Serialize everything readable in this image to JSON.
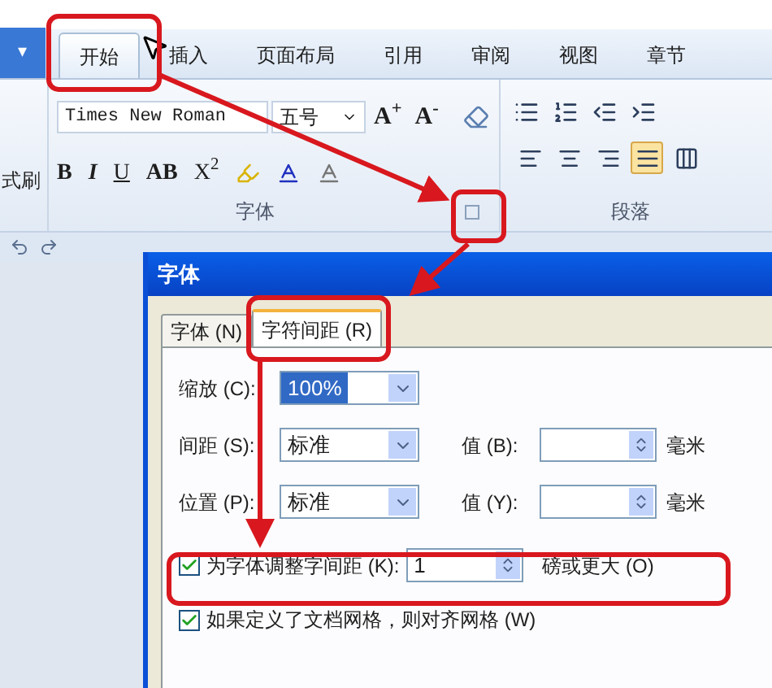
{
  "ribbon": {
    "menu_button": "▾",
    "tabs": [
      {
        "label": "开始",
        "selected": true
      },
      {
        "label": "插入",
        "selected": false
      },
      {
        "label": "页面布局",
        "selected": false
      },
      {
        "label": "引用",
        "selected": false
      },
      {
        "label": "审阅",
        "selected": false
      },
      {
        "label": "视图",
        "selected": false
      },
      {
        "label": "章节",
        "selected": false
      }
    ],
    "clipboard_label": "式刷",
    "font_group": {
      "title": "字体",
      "font_name": "Times New Roman",
      "font_size": "五号",
      "size_buttons": [
        "A$^{+}$",
        "A$^{-}$"
      ],
      "style_buttons": [
        "B",
        "I",
        "U",
        "AB",
        "X$^{2}$"
      ]
    },
    "paragraph_group": {
      "title": "段落",
      "align_buttons": [
        {
          "kind": "left",
          "selected": false
        },
        {
          "kind": "center",
          "selected": false
        },
        {
          "kind": "right",
          "selected": false
        },
        {
          "kind": "justify",
          "selected": true
        },
        {
          "kind": "distributed",
          "selected": false
        }
      ]
    }
  },
  "dialog": {
    "title": "字体",
    "tabs": [
      {
        "label": "字体 (N)",
        "selected": false
      },
      {
        "label": "字符间距 (R)",
        "selected": true
      }
    ],
    "scale": {
      "label": "缩放 (C):",
      "value": "100%"
    },
    "spacing": {
      "label": "间距 (S):",
      "value": "标准",
      "value_label": "值 (B):",
      "unit": "毫米"
    },
    "position": {
      "label": "位置 (P):",
      "value": "标准",
      "value_label": "值 (Y):",
      "unit": "毫米"
    },
    "kerning": {
      "checked": true,
      "label": "为字体调整字间距 (K):",
      "value": "1",
      "suffix": "磅或更大 (O)"
    },
    "grid": {
      "checked": true,
      "label": "如果定义了文档网格，则对齐网格 (W)"
    }
  }
}
